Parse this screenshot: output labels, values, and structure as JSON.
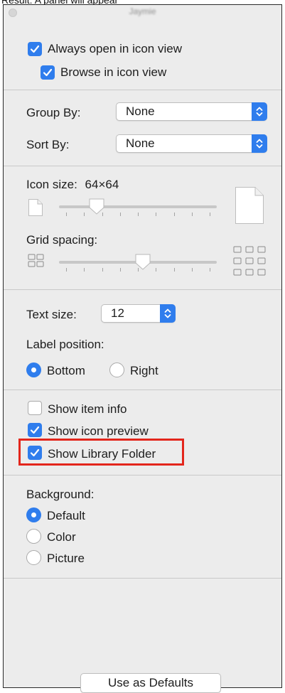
{
  "caption": "Result: A panel will appear",
  "window": {
    "title": "Jaymie"
  },
  "checkboxes_top": {
    "always_open": {
      "label": "Always open in icon view",
      "checked": true
    },
    "browse": {
      "label": "Browse in icon view",
      "checked": true
    }
  },
  "group_by": {
    "label": "Group By:",
    "value": "None"
  },
  "sort_by": {
    "label": "Sort By:",
    "value": "None"
  },
  "icon_size": {
    "label": "Icon size:",
    "value": "64×64",
    "level": 0.24
  },
  "grid_spacing": {
    "label": "Grid spacing:",
    "level": 0.53
  },
  "text_size": {
    "label": "Text size:",
    "value": "12"
  },
  "label_position": {
    "label": "Label position:",
    "options": [
      {
        "label": "Bottom",
        "selected": true
      },
      {
        "label": "Right",
        "selected": false
      }
    ]
  },
  "show_options": [
    {
      "label": "Show item info",
      "checked": false
    },
    {
      "label": "Show icon preview",
      "checked": true
    },
    {
      "label": "Show Library Folder",
      "checked": true,
      "highlighted": true
    }
  ],
  "background": {
    "label": "Background:",
    "options": [
      {
        "label": "Default",
        "selected": true
      },
      {
        "label": "Color",
        "selected": false
      },
      {
        "label": "Picture",
        "selected": false
      }
    ]
  },
  "defaults_button": "Use as Defaults",
  "colors": {
    "accent": "#2f7ded",
    "highlight": "#e3261c"
  }
}
